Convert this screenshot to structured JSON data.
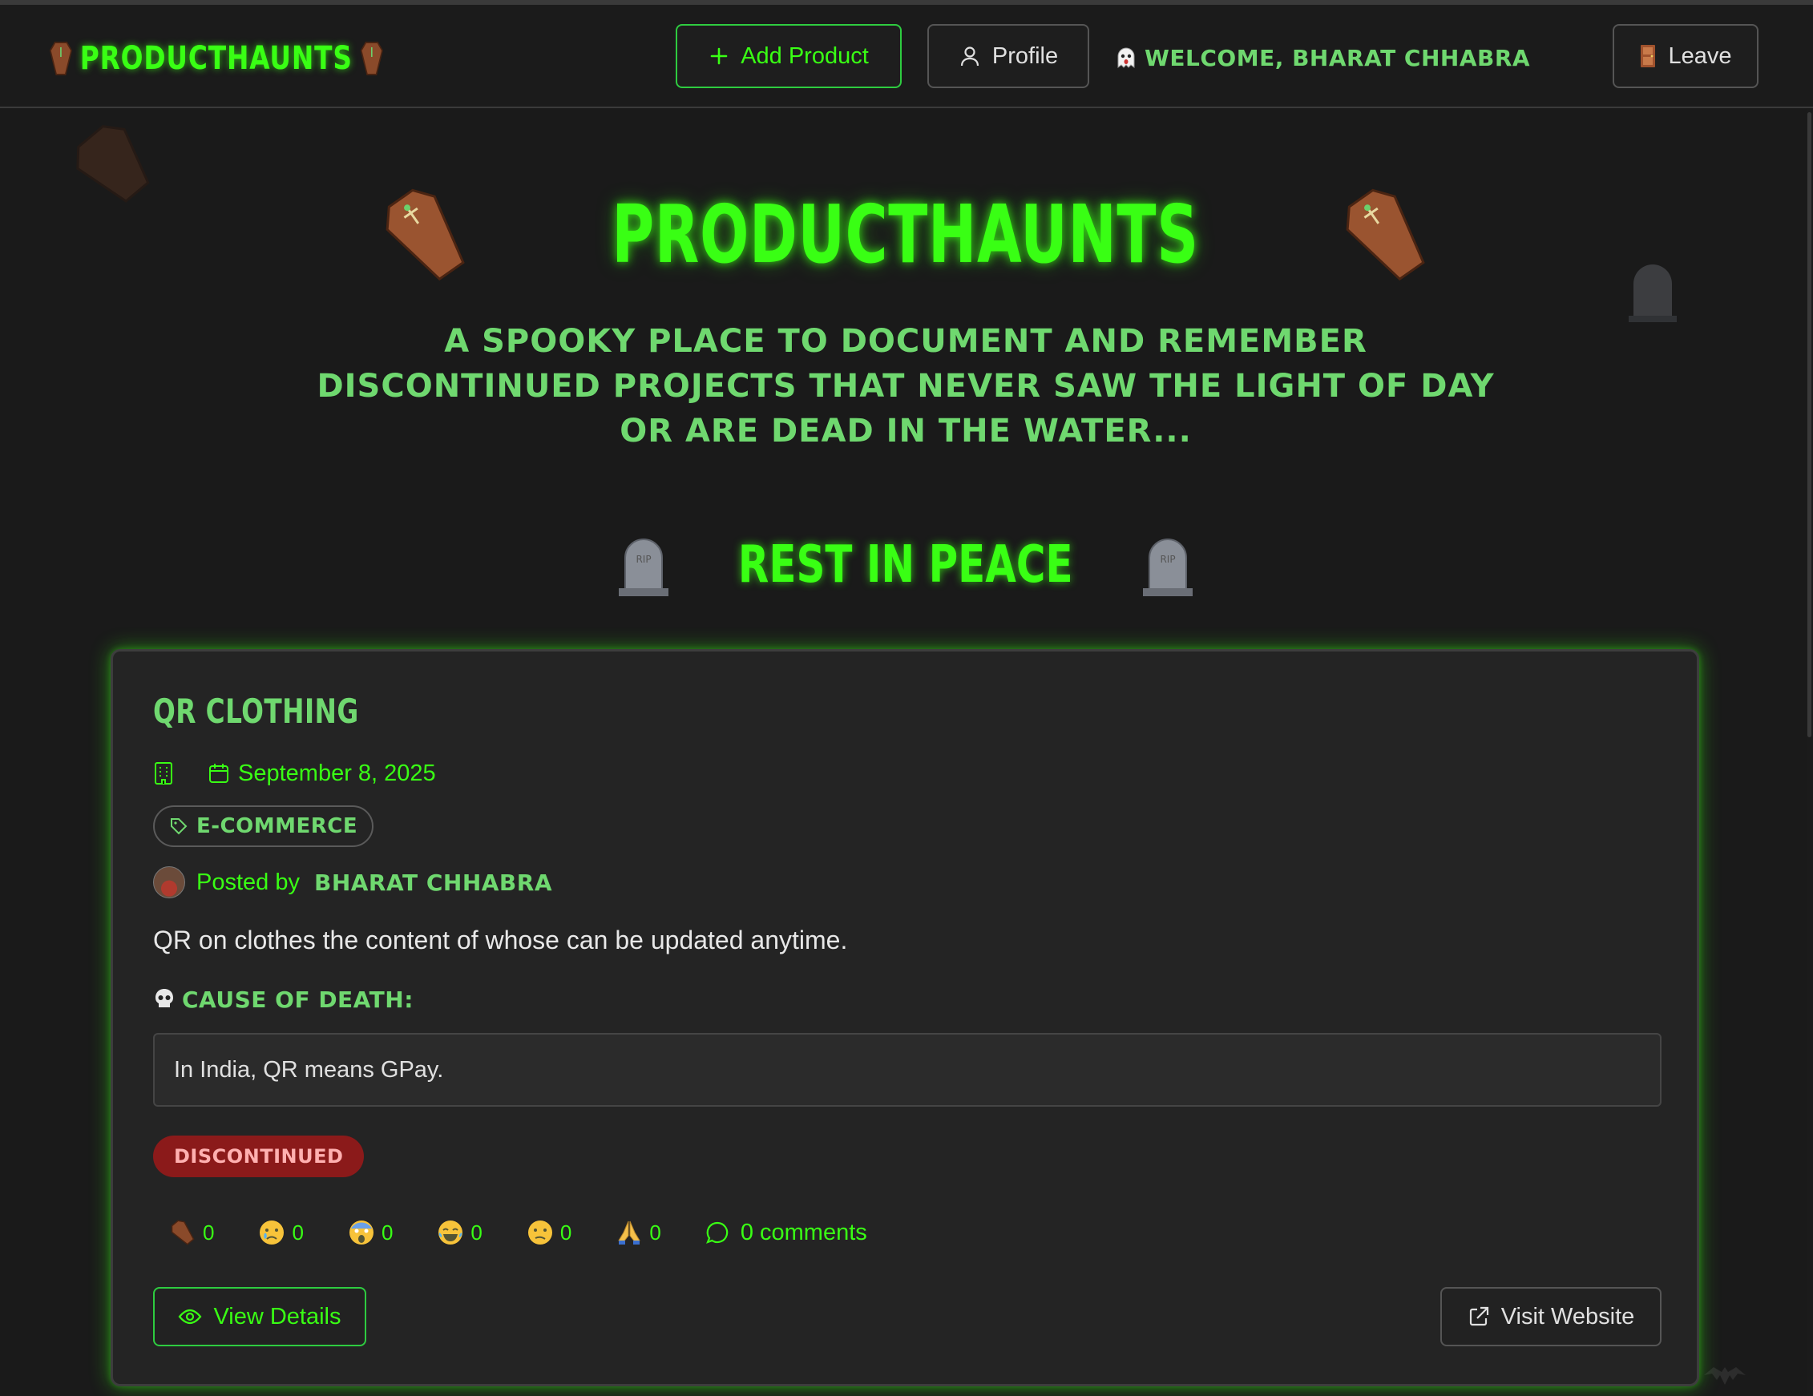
{
  "nav": {
    "brand": "PRODUCTHAUNTS",
    "add_product": "Add Product",
    "profile": "Profile",
    "welcome": "WELCOME, BHARAT CHHABRA",
    "leave": "Leave"
  },
  "hero": {
    "title": "PRODUCTHAUNTS",
    "subtitle": "A spooky place to document and remember discontinued projects that never saw the light of day or are dead in the water...",
    "section_title": "REST IN PEACE"
  },
  "product": {
    "title": "QR CLOTHING",
    "date": "September 8, 2025",
    "category": "E-COMMERCE",
    "posted_by_label": "Posted by",
    "author": "BHARAT CHHABRA",
    "description": "QR on clothes the content of whose can be updated anytime.",
    "cause_label": "CAUSE OF DEATH:",
    "cause": "In India, QR means GPay.",
    "status": "DISCONTINUED",
    "reactions": [
      {
        "icon": "coffin-icon",
        "count": "0"
      },
      {
        "icon": "crying-face-icon",
        "count": "0"
      },
      {
        "icon": "screaming-face-icon",
        "count": "0"
      },
      {
        "icon": "laughing-face-icon",
        "count": "0"
      },
      {
        "icon": "confused-face-icon",
        "count": "0"
      },
      {
        "icon": "praying-hands-icon",
        "count": "0"
      }
    ],
    "comments": "0 comments",
    "view_details": "View Details",
    "visit_website": "Visit Website"
  },
  "colors": {
    "accent": "#39ff14",
    "muted_green": "#6fd86f",
    "background": "#1a1a1a",
    "card": "#242424",
    "status_red": "#8b1a1a"
  }
}
